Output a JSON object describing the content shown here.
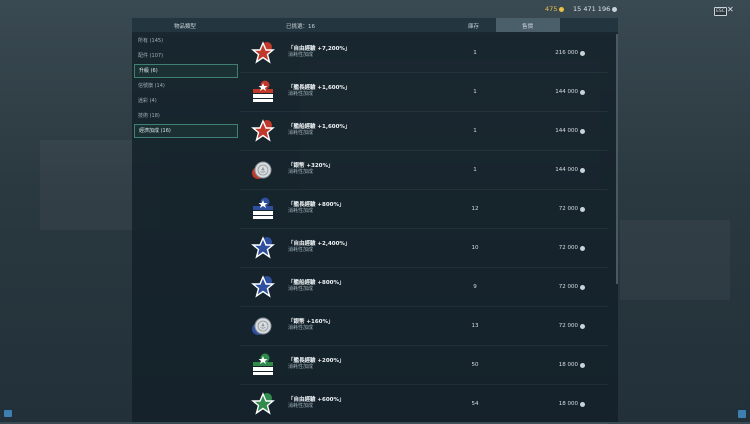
{
  "currency": {
    "gold": "475",
    "credits": "15 471 196",
    "gold_icon": "gold-coin-icon",
    "credits_icon": "silver-coin-icon"
  },
  "controls": {
    "esc_label": "ESC",
    "close_label": "✕"
  },
  "header": {
    "type_col": "物品類型",
    "selected_label": "已挑選：16",
    "qty_col": "庫存",
    "price_col": "售價"
  },
  "sidebar": {
    "items": [
      {
        "label": "所有 (145)",
        "active": false
      },
      {
        "label": "配件 (107)",
        "active": false
      },
      {
        "label": "升級 (6)",
        "active": true
      },
      {
        "label": "信號旗 (14)",
        "active": false
      },
      {
        "label": "迷彩 (4)",
        "active": false
      },
      {
        "label": "技術 (18)",
        "active": false
      },
      {
        "label": "經濟加成 (16)",
        "active": true
      }
    ]
  },
  "rows": [
    {
      "name": "「自由經驗 +7,200%」",
      "desc": "消耗性加成",
      "qty": "1",
      "price": "216 000",
      "icon": "star-red-icon"
    },
    {
      "name": "「艦長經驗 +1,600%」",
      "desc": "消耗性加成",
      "qty": "1",
      "price": "144 000",
      "icon": "chevron-red-icon"
    },
    {
      "name": "「艦船經驗 +1,600%」",
      "desc": "消耗性加成",
      "qty": "1",
      "price": "144 000",
      "icon": "star-red-icon"
    },
    {
      "name": "「銀幣 +320%」",
      "desc": "消耗性加成",
      "qty": "1",
      "price": "144 000",
      "icon": "coin-red-icon"
    },
    {
      "name": "「艦長經驗 +800%」",
      "desc": "消耗性加成",
      "qty": "12",
      "price": "72 000",
      "icon": "chevron-blue-icon"
    },
    {
      "name": "「自由經驗 +2,400%」",
      "desc": "消耗性加成",
      "qty": "10",
      "price": "72 000",
      "icon": "star-blue-icon"
    },
    {
      "name": "「艦船經驗 +800%」",
      "desc": "消耗性加成",
      "qty": "9",
      "price": "72 000",
      "icon": "star-blue-icon"
    },
    {
      "name": "「銀幣 +160%」",
      "desc": "消耗性加成",
      "qty": "13",
      "price": "72 000",
      "icon": "coin-blue-icon"
    },
    {
      "name": "「艦長經驗 +200%」",
      "desc": "消耗性加成",
      "qty": "50",
      "price": "18 000",
      "icon": "chevron-green-icon"
    },
    {
      "name": "「自由經驗 +600%」",
      "desc": "消耗性加成",
      "qty": "54",
      "price": "18 000",
      "icon": "star-green-icon"
    }
  ],
  "colors": {
    "red": "#c0392b",
    "blue": "#2d4f9e",
    "green": "#2f8a4c",
    "accent_border": "#3f7f74"
  }
}
